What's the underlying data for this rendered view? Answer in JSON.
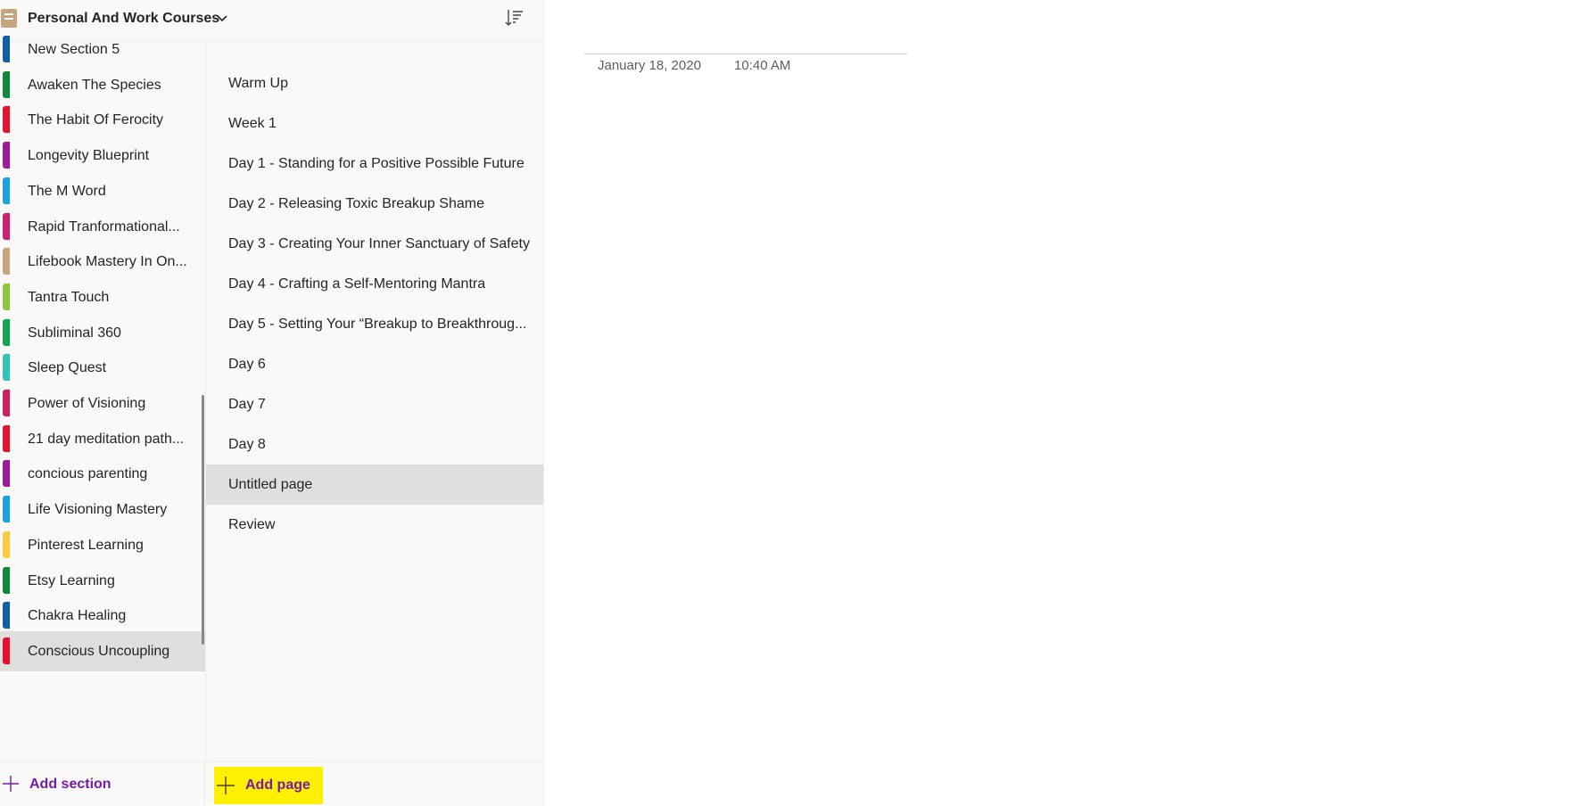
{
  "notebook": {
    "title": "Personal And Work Courses",
    "icon": "notebook-icon",
    "accent": "#c8a47e"
  },
  "sections": [
    {
      "label": "New Section 5",
      "color": "#0f5fa8"
    },
    {
      "label": "Awaken The Species",
      "color": "#0f8a3c"
    },
    {
      "label": "The Habit Of Ferocity",
      "color": "#e8102c"
    },
    {
      "label": "Longevity Blueprint",
      "color": "#9b1b9b"
    },
    {
      "label": "The M Word",
      "color": "#1aa3e0"
    },
    {
      "label": "Rapid Tranformational...",
      "color": "#d01e73"
    },
    {
      "label": "Lifebook Mastery In On...",
      "color": "#c9a57f"
    },
    {
      "label": "Tantra Touch",
      "color": "#8cc63f"
    },
    {
      "label": "Subliminal 360",
      "color": "#12a653"
    },
    {
      "label": "Sleep Quest",
      "color": "#2ec4b6"
    },
    {
      "label": "Power of Visioning",
      "color": "#d01e5f"
    },
    {
      "label": "21 day meditation path...",
      "color": "#e8102c"
    },
    {
      "label": "concious parenting",
      "color": "#9b1b9b"
    },
    {
      "label": "Life Visioning Mastery",
      "color": "#1aa3e0"
    },
    {
      "label": "Pinterest Learning",
      "color": "#ffc83d"
    },
    {
      "label": "Etsy Learning",
      "color": "#0f8a3c"
    },
    {
      "label": "Chakra Healing",
      "color": "#0f5fa8"
    },
    {
      "label": "Conscious Uncoupling",
      "color": "#e8102c",
      "selected": true
    }
  ],
  "pages": [
    {
      "label": "Warm Up"
    },
    {
      "label": "Week 1"
    },
    {
      "label": "Day 1 - Standing for a Positive Possible Future"
    },
    {
      "label": "Day 2 - Releasing Toxic Breakup Shame"
    },
    {
      "label": "Day 3 - Creating Your Inner Sanctuary of Safety"
    },
    {
      "label": "Day 4 - Crafting a Self-Mentoring Mantra"
    },
    {
      "label": "Day 5 - Setting Your “Breakup to Breakthroug..."
    },
    {
      "label": "Day 6"
    },
    {
      "label": "Day 7"
    },
    {
      "label": "Day 8"
    },
    {
      "label": "Untitled page",
      "selected": true
    },
    {
      "label": "Review"
    }
  ],
  "bottom": {
    "add_section_label": "Add section",
    "add_page_label": "Add page",
    "accent": "#7719aa",
    "highlight": "#ffef00"
  },
  "content": {
    "date": "January 18, 2020",
    "time": "10:40 AM"
  }
}
